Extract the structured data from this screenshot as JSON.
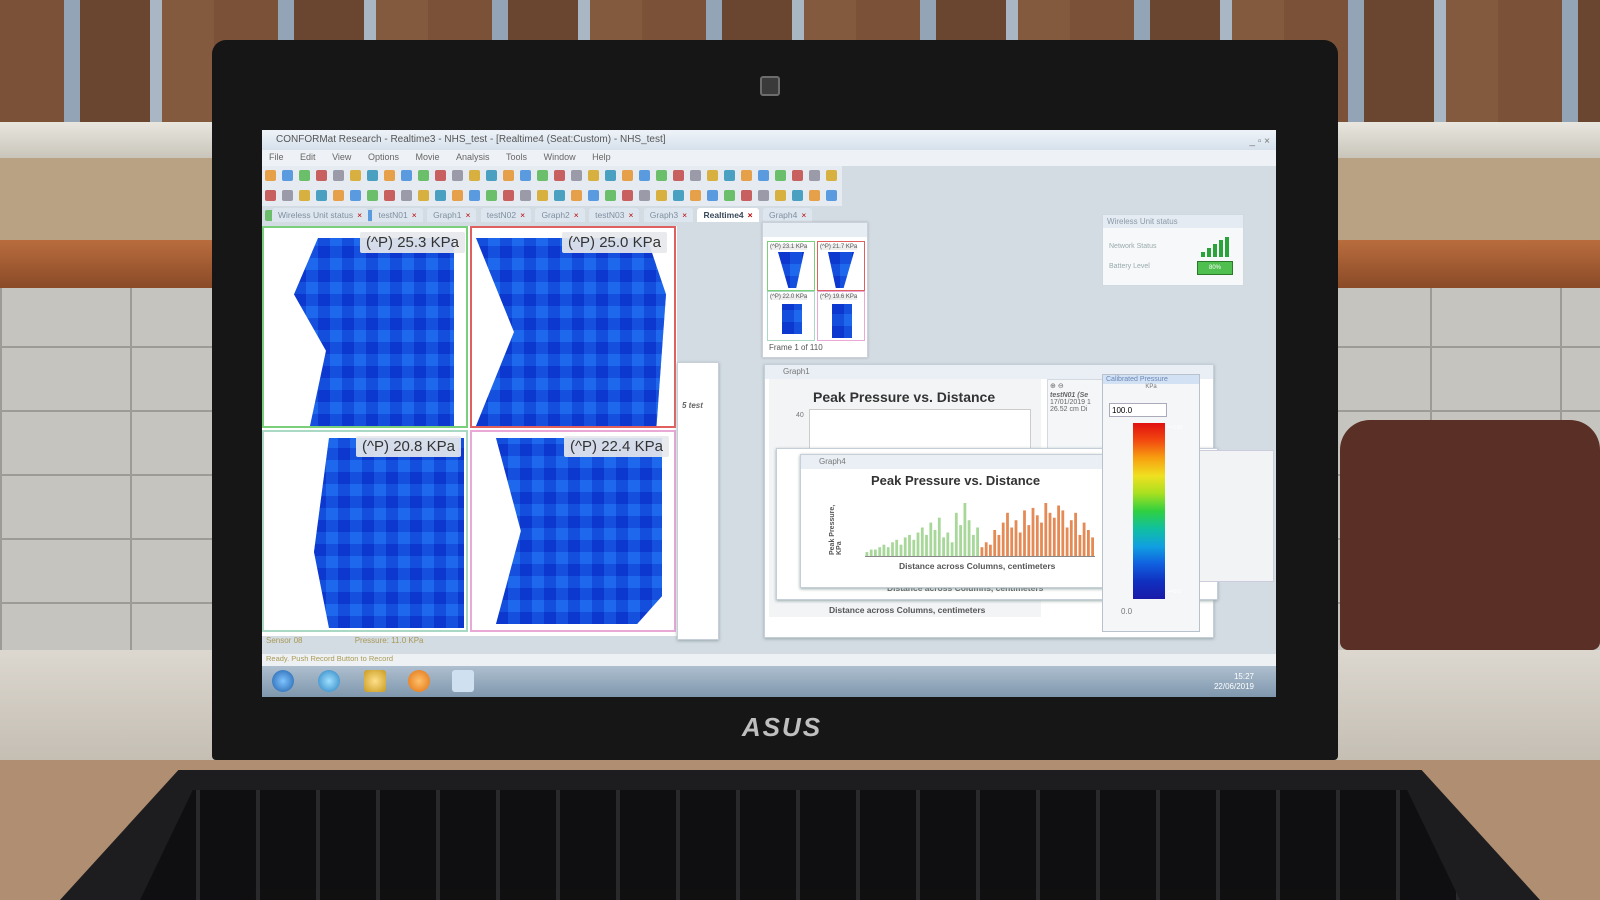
{
  "window": {
    "title": "CONFORMat Research - Realtime3 - NHS_test - [Realtime4 (Seat:Custom) - NHS_test]",
    "controls": "_ ▫ ×"
  },
  "menu": [
    "File",
    "Edit",
    "View",
    "Options",
    "Movie",
    "Analysis",
    "Tools",
    "Window",
    "Help"
  ],
  "tabs": [
    {
      "label": "Wireless Unit status",
      "selected": false
    },
    {
      "label": "testN01",
      "selected": false
    },
    {
      "label": "Graph1",
      "selected": false
    },
    {
      "label": "testN02",
      "selected": false
    },
    {
      "label": "Graph2",
      "selected": false
    },
    {
      "label": "testN03",
      "selected": false
    },
    {
      "label": "Graph3",
      "selected": false
    },
    {
      "label": "Realtime4",
      "selected": true
    },
    {
      "label": "Graph4",
      "selected": false
    }
  ],
  "pressure_map": {
    "quadrants": [
      {
        "label": "(^P) 25.3 KPa"
      },
      {
        "label": "(^P) 25.0 KPa"
      },
      {
        "label": "(^P) 20.8 KPa"
      },
      {
        "label": "(^P) 22.4 KPa"
      }
    ],
    "sensor": "Sensor 08",
    "pressure": "Pressure: 11.0 KPa"
  },
  "thumbnail": {
    "labels": [
      "(^P) 23.1 KPa",
      "(^P) 21.7 KPa",
      "(^P) 22.0 KPa",
      "(^P) 19.6 KPa"
    ],
    "frame": "Frame 1 of 110"
  },
  "wireless": {
    "title": "Wireless Unit status",
    "network_label": "Network Status",
    "battery_label": "Battery Level",
    "battery_value": "80%"
  },
  "graph1": {
    "title": "Graph1",
    "chart_title": "Peak Pressure vs. Distance",
    "ytick": "40",
    "xlabel": "Distance across Columns, centimeters",
    "side_text": "testN01 (Se",
    "date": "17/01/2019 1",
    "date2": "26.52 cm Di"
  },
  "graph4": {
    "title": "Graph4",
    "chart_title": "Peak Pressure vs. Distance",
    "ylabel": "Peak Pressure, KPa",
    "xlabel": "Distance across Columns, centimeters"
  },
  "graph_mid": {
    "xlabel": "Distance across Columns, centimeters"
  },
  "stub_text": "5 test",
  "scale": {
    "title": "Calibrated Pressure",
    "unit": "KPa",
    "max": "100.0",
    "min": "0.0",
    "ramp_labels": [
      ">=100",
      "",
      "",
      "",
      "",
      "",
      "",
      "",
      "",
      "",
      ">=0.0"
    ]
  },
  "statusbar": "Ready. Push Record Button to Record",
  "clock": {
    "time": "15:27",
    "date": "22/06/2019"
  },
  "laptop_brand": "ASUS",
  "colors": {
    "pressure_blue": "#1a55e0",
    "bar_green": "#a7d89a",
    "bar_orange": "#e58a55"
  },
  "chart_data": {
    "type": "bar",
    "title": "Peak Pressure vs. Distance",
    "xlabel": "Distance across Columns, centimeters",
    "ylabel": "Peak Pressure, KPa",
    "series": [
      {
        "values": [
          2,
          3,
          3,
          4,
          5,
          4,
          6,
          7,
          5,
          8,
          9,
          7,
          10,
          12,
          9,
          14,
          11,
          16,
          8,
          10,
          6,
          18,
          13,
          22,
          15,
          9,
          12
        ]
      },
      {
        "values": [
          4,
          6,
          5,
          11,
          9,
          14,
          18,
          12,
          15,
          10,
          19,
          13,
          20,
          17,
          14,
          22,
          18,
          16,
          21,
          19,
          12,
          15,
          18,
          9,
          14,
          11,
          8
        ]
      }
    ]
  }
}
